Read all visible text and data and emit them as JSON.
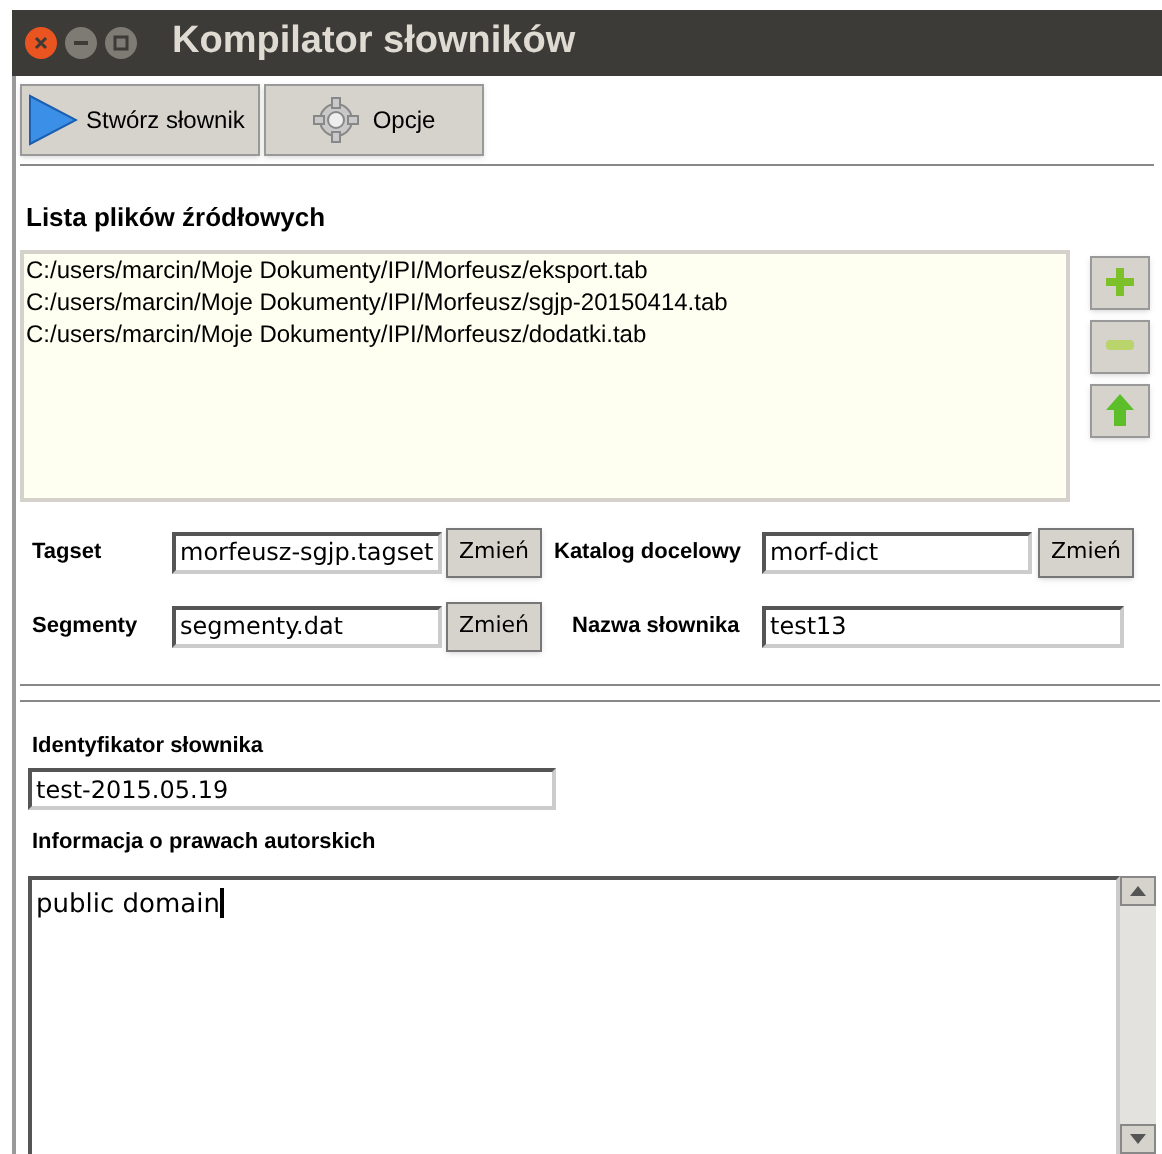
{
  "window": {
    "title": "Kompilator słowników"
  },
  "toolbar": [
    {
      "kind": "run",
      "label": "Stwórz słownik"
    },
    {
      "kind": "options",
      "label": "Opcje"
    }
  ],
  "source_files": {
    "heading": "Lista plików źródłowych",
    "items": [
      "C:/users/marcin/Moje Dokumenty/IPI/Morfeusz/eksport.tab",
      "C:/users/marcin/Moje Dokumenty/IPI/Morfeusz/sgjp-20150414.tab",
      "C:/users/marcin/Moje Dokumenty/IPI/Morfeusz/dodatki.tab"
    ],
    "buttons": [
      {
        "kind": "add"
      },
      {
        "kind": "remove"
      },
      {
        "kind": "up"
      }
    ]
  },
  "fields": [
    {
      "label": "Tagset",
      "value": "morfeusz-sgjp.tagset",
      "button": "Zmień"
    },
    {
      "label": "Katalog docelowy",
      "value": "morf-dict",
      "button": "Zmień"
    },
    {
      "label": "Segmenty",
      "value": "segmenty.dat",
      "button": "Zmień"
    },
    {
      "label": "Nazwa słownika",
      "value": "test13"
    }
  ],
  "identifier": {
    "label": "Identyfikator słownika",
    "value": "test-2015.05.19"
  },
  "copyright": {
    "label": "Informacja o prawach autorskich",
    "value": "public domain"
  }
}
